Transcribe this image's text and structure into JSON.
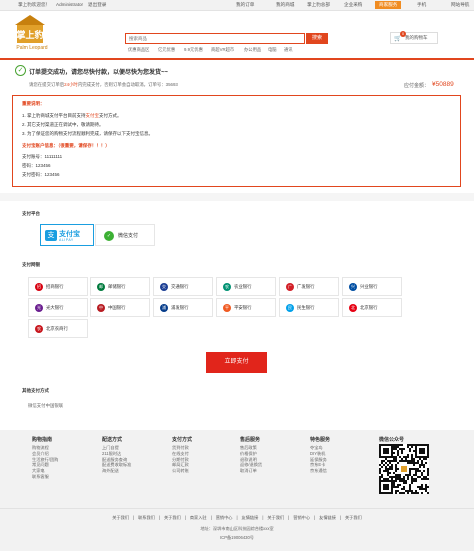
{
  "topbar": {
    "welcome": "掌上豹欢迎您！",
    "user": "Administrator",
    "logout": "退出登录",
    "links": [
      "我的订单",
      "我的商城",
      "掌上豹总部",
      "企业采购",
      "商家服务",
      "手机",
      "网站导航"
    ]
  },
  "brand": {
    "logo_text": "Palm Leopard",
    "logo_name": "掌上豹"
  },
  "search": {
    "placeholder": "搜索商品",
    "button": "搜索",
    "hotwords": [
      "优惠商品区",
      "亿元优惠",
      "9.9元优惠",
      "商超VR超市",
      "办公用品",
      "电脑",
      "通讯"
    ]
  },
  "cart": {
    "label": "我的购物车",
    "count": "0"
  },
  "order": {
    "success_title": "订单提交成功，请您尽快付款，以便尽快为您发货~~",
    "detail_prefix": "请您在提交订单后",
    "detail_highlight": "24小时",
    "detail_suffix": "内完成支付，否则订单会自动取消。订单号：35693",
    "amount_label": "应付金额：",
    "amount_value": "¥50889"
  },
  "notice": {
    "title": "重要说明：",
    "line1": "1. 掌上豹商城支付平台目前支持",
    "line1_strong": "支付宝",
    "line1_end": "支付方式。",
    "line2": "2. 其它支付渠道正在调试中，敬请期待。",
    "line3": "3. 为了保证您的购物支付流程顺利完成，请保存以下支付宝信息。",
    "account_title": "支付宝账户信息：（很重要，请保存！！！）",
    "account": "支付账号：11111111",
    "password": "密码：123456",
    "pay_password": "支付密码：123456"
  },
  "platform": {
    "title": "支付平台",
    "alipay_zh": "支付宝",
    "alipay_en": "ALIPAY",
    "wechat": "微信支付"
  },
  "banks": {
    "title": "支付网银",
    "items": [
      {
        "name": "招商银行",
        "color": "#d7000f",
        "glyph": "招"
      },
      {
        "name": "邮储银行",
        "color": "#007a3d",
        "glyph": "邮"
      },
      {
        "name": "交通银行",
        "color": "#1c3f94",
        "glyph": "交"
      },
      {
        "name": "农业银行",
        "color": "#009172",
        "glyph": "农"
      },
      {
        "name": "广发银行",
        "color": "#d21f27",
        "glyph": "广"
      },
      {
        "name": "兴业银行",
        "color": "#004ea2",
        "glyph": "兴"
      },
      {
        "name": "光大银行",
        "color": "#6a1e8f",
        "glyph": "光"
      },
      {
        "name": "中国银行",
        "color": "#b81c22",
        "glyph": "中"
      },
      {
        "name": "浦发银行",
        "color": "#053c8a",
        "glyph": "浦"
      },
      {
        "name": "平安银行",
        "color": "#f05a22",
        "glyph": "平"
      },
      {
        "name": "民生银行",
        "color": "#00a0e9",
        "glyph": "民"
      },
      {
        "name": "北京银行",
        "color": "#e60012",
        "glyph": "北"
      },
      {
        "name": "北京农商行",
        "color": "#c8161d",
        "glyph": "农"
      }
    ]
  },
  "pay_button": "立即支付",
  "other": {
    "title": "其他支付方式",
    "item": "微信支付中国银联"
  },
  "footer": {
    "columns": [
      {
        "title": "购物指南",
        "items": [
          "购物流程",
          "会员介绍",
          "生活旅行/团购",
          "常见问题",
          "大家电",
          "联系客服"
        ]
      },
      {
        "title": "配送方式",
        "items": [
          "上门自提",
          "211限时达",
          "配送服务查询",
          "配送费收取标准",
          "海外配送"
        ]
      },
      {
        "title": "支付方式",
        "items": [
          "货到付款",
          "在线支付",
          "分期付款",
          "邮局汇款",
          "公司转账"
        ]
      },
      {
        "title": "售后服务",
        "items": [
          "售后政策",
          "价格保护",
          "退款说明",
          "返修/退换货",
          "取消订单"
        ]
      },
      {
        "title": "特色服务",
        "items": [
          "夺宝岛",
          "DIY装机",
          "延保服务",
          "京东E卡",
          "京东通信"
        ]
      }
    ],
    "qr_title": "微信公众号",
    "links": [
      "关于我们",
      "联系我们",
      "关于我们",
      "商家入驻",
      "营销中心",
      "友情链接",
      "关于我们",
      "营销中心",
      "友情链接",
      "关于我们"
    ],
    "address": "地址：深圳市南山区科技园综合楼xxx室",
    "icp": "ICP备19006430号"
  }
}
